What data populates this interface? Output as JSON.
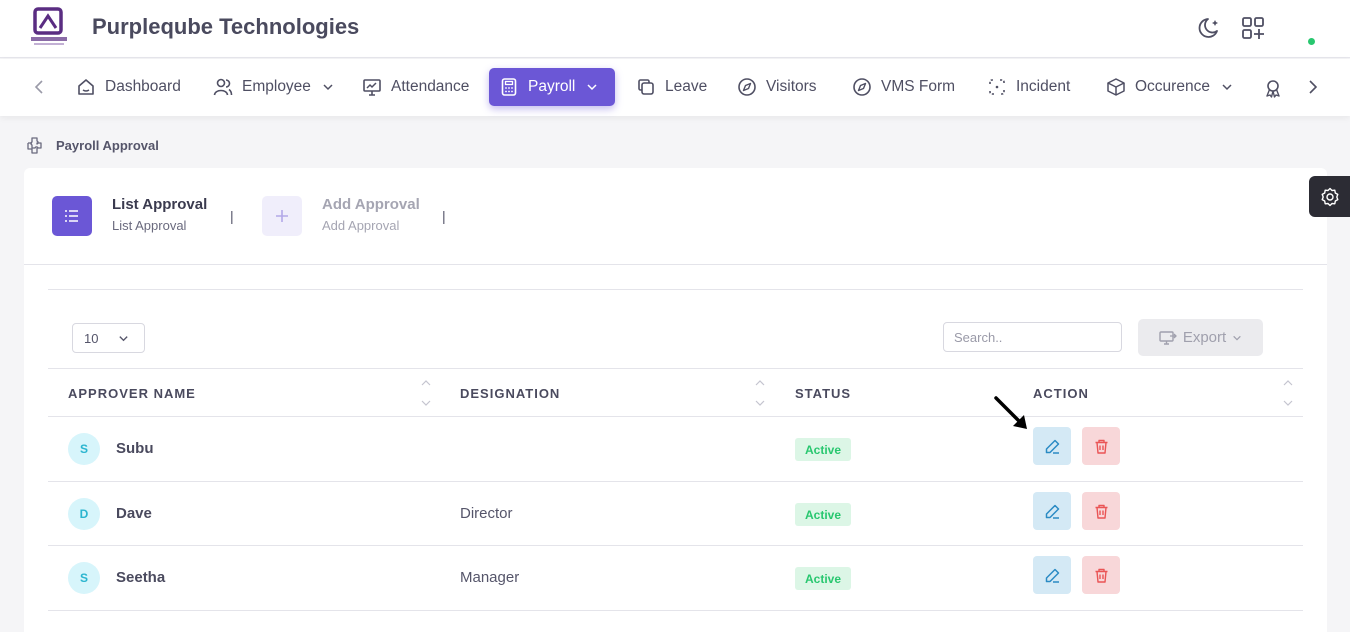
{
  "header": {
    "company_name": "Purpleqube Technologies",
    "icons": [
      "purpleqube-logo",
      "moon-icon",
      "apps-add-icon",
      "online-status-dot"
    ]
  },
  "nav": {
    "items": [
      {
        "label": "Dashboard",
        "icon": "home-icon"
      },
      {
        "label": "Employee",
        "icon": "users-icon",
        "has_dropdown": true
      },
      {
        "label": "Attendance",
        "icon": "monitor-chart-icon"
      },
      {
        "label": "Payroll",
        "icon": "calculator-icon",
        "has_dropdown": true,
        "active": true
      },
      {
        "label": "Leave",
        "icon": "copy-icon"
      },
      {
        "label": "Visitors",
        "icon": "compass-icon"
      },
      {
        "label": "VMS Form",
        "icon": "compass-icon"
      },
      {
        "label": "Incident",
        "icon": "focus-icon"
      },
      {
        "label": "Occurence",
        "icon": "box-icon",
        "has_dropdown": true
      }
    ],
    "accent_color": "#6b57d6"
  },
  "breadcrumb": {
    "current": "Payroll Approval"
  },
  "tabs": [
    {
      "title": "List Approval",
      "subtitle": "List Approval",
      "active": true
    },
    {
      "title": "Add Approval",
      "subtitle": "Add Approval",
      "active": false
    }
  ],
  "tab_separator": "|",
  "table_controls": {
    "page_length": "10",
    "search_placeholder": "Search..",
    "export_label": "Export"
  },
  "table": {
    "columns": [
      "APPROVER NAME",
      "DESIGNATION",
      "STATUS",
      "ACTION"
    ],
    "rows": [
      {
        "initial": "S",
        "name": "Subu",
        "designation": "",
        "status": "Active"
      },
      {
        "initial": "D",
        "name": "Dave",
        "designation": "Director",
        "status": "Active"
      },
      {
        "initial": "S",
        "name": "Seetha",
        "designation": "Manager",
        "status": "Active"
      }
    ]
  },
  "colors": {
    "status_active": "#28c76f",
    "edit": "#2b8bc4",
    "delete": "#ea5455"
  }
}
